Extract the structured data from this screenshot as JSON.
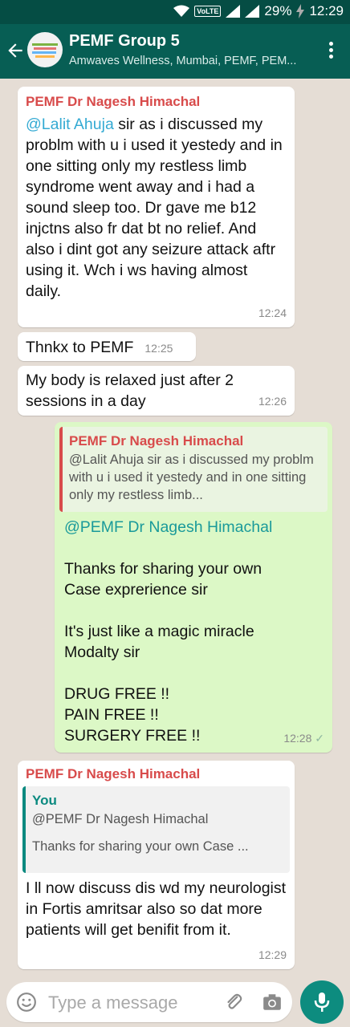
{
  "status_bar": {
    "volte": "VoLTE",
    "battery": "29%",
    "time": "12:29"
  },
  "header": {
    "title": "PEMF Group 5",
    "subtitle": "Amwaves Wellness, Mumbai, PEMF, PEM..."
  },
  "messages": [
    {
      "sender": "PEMF Dr Nagesh Himachal",
      "mention": "@Lalit Ahuja",
      "text": " sir as i discussed my problm with u i used it yestedy and in one sitting only my restless limb syndrome went away and i had a sound sleep too. Dr gave me b12 injctns also fr dat bt no relief. And also i dint got any seizure attack aftr using it. Wch i ws having almost daily.",
      "time": "12:24"
    },
    {
      "text": "Thnkx to PEMF",
      "time": "12:25"
    },
    {
      "text": "My body is relaxed just after 2 sessions in a day",
      "time": "12:26"
    },
    {
      "quote_author": "PEMF Dr Nagesh Himachal",
      "quote_text": "@Lalit Ahuja sir as i discussed my problm with u i used it yestedy and in one sitting only my restless limb...",
      "mention": "@PEMF Dr Nagesh Himachal",
      "line1": "Thanks for sharing your own",
      "line2": "Case exprerience sir",
      "line3": "It's just like a magic miracle",
      "line4": "Modalty sir",
      "line5": "DRUG FREE  !!",
      "line6": "PAIN FREE !!",
      "line7": "SURGERY FREE !!",
      "time": "12:28"
    },
    {
      "sender": "PEMF Dr Nagesh Himachal",
      "quote_author": "You",
      "quote_line1": "@PEMF Dr Nagesh Himachal",
      "quote_line2": "Thanks for sharing your own Case ...",
      "text": "I ll now discuss dis wd my neurologist in Fortis amritsar also so dat more patients will get benifit from it.",
      "time": "12:29"
    }
  ],
  "input": {
    "placeholder": "Type a message"
  },
  "icons": {
    "back": "arrow-left-icon",
    "menu": "more-vert-icon",
    "emoji": "emoji-icon",
    "attach": "paperclip-icon",
    "camera": "camera-icon",
    "mic": "mic-icon"
  },
  "colors": {
    "header": "#075e54",
    "outgoing": "#dcf8c6",
    "sender_name": "#d84b4b",
    "mention": "#34aad3",
    "mic_button": "#0d8c7f"
  }
}
